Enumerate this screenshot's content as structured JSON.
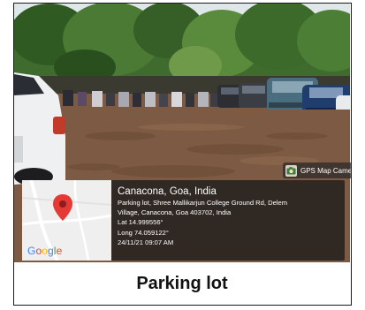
{
  "photo": {
    "scene": "outdoor-parking-lot-photo",
    "sky_color": "#dfe7e9",
    "foliage_color": "#3f6b2f",
    "ground_color": "#7d5a43"
  },
  "gps_badge": {
    "label": "GPS Map Camera",
    "icon": "camera-icon"
  },
  "map": {
    "logo_letters": [
      "G",
      "o",
      "o",
      "g",
      "l",
      "e"
    ],
    "logo_colors": [
      "#4285f4",
      "#ea4335",
      "#fbbc05",
      "#4285f4",
      "#34a853",
      "#ea4335"
    ],
    "pin_color": "#e53935",
    "pin_icon": "map-pin-icon"
  },
  "location": {
    "title": "Canacona, Goa, India",
    "address_line1": "Parking lot, Shree Mallikarjun College Ground Rd, Delem",
    "address_line2": "Village, Canacona, Goa 403702, India",
    "latitude": "Lat 14.999556°",
    "longitude": "Long 74.059122°",
    "timestamp": "24/11/21 09:07 AM"
  },
  "caption": {
    "text": "Parking lot"
  }
}
